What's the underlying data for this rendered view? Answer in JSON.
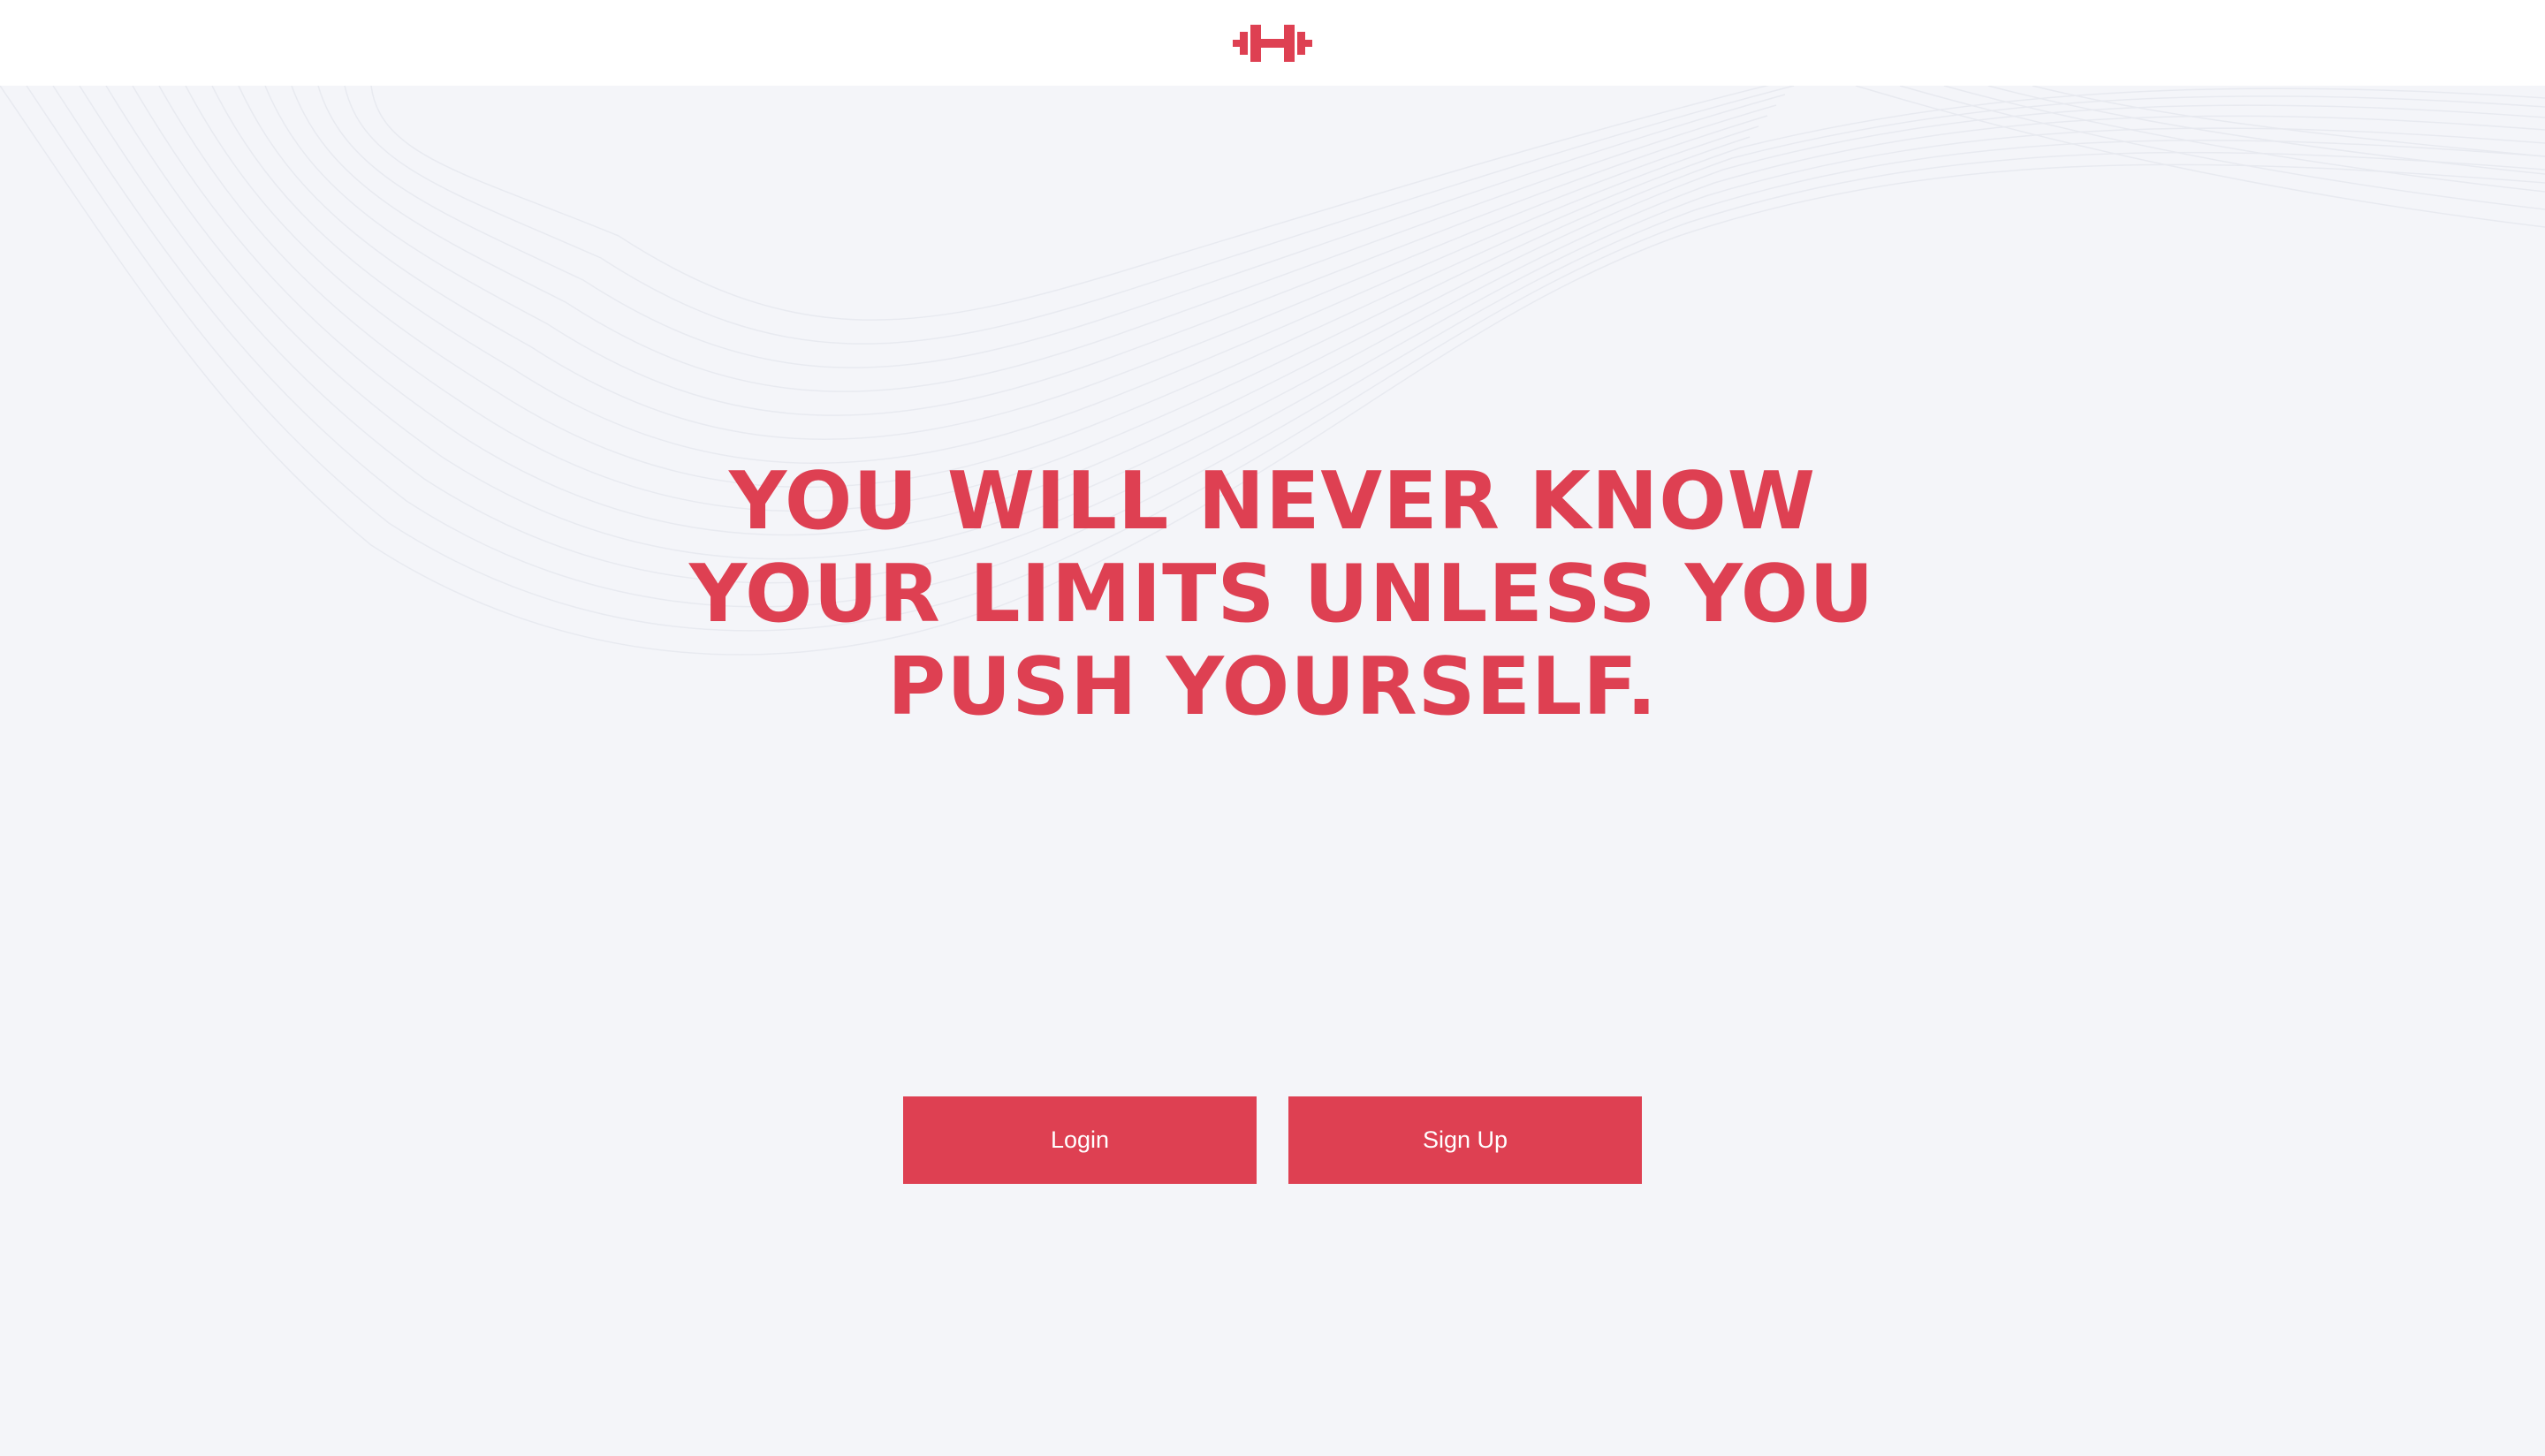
{
  "header": {
    "logo_icon": "dumbbell-icon",
    "accent_color": "#de4052"
  },
  "hero": {
    "headline_lines": [
      "YOU WILL NEVER KNOW",
      "YOUR LIMITS UNLESS YOU",
      "PUSH YOURSELF."
    ]
  },
  "actions": {
    "login_label": "Login",
    "signup_label": "Sign Up"
  },
  "colors": {
    "background": "#f4f5f9",
    "header_background": "#ffffff",
    "button_text": "#ffffff"
  }
}
